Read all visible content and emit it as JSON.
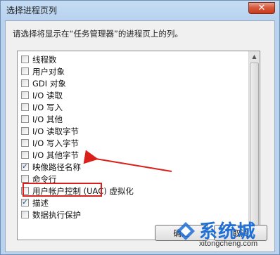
{
  "window": {
    "title": "选择进程页列",
    "close_glyph": "✕"
  },
  "instruction": "请选择将显示在“任务管理器”的进程页上的列。",
  "columns": [
    {
      "label": "线程数",
      "checked": false
    },
    {
      "label": "用户对象",
      "checked": false
    },
    {
      "label": "GDI 对象",
      "checked": false
    },
    {
      "label": "I/O 读取",
      "checked": false
    },
    {
      "label": "I/O 写入",
      "checked": false
    },
    {
      "label": "I/O 其他",
      "checked": false
    },
    {
      "label": "I/O 读取字节",
      "checked": false
    },
    {
      "label": "I/O 写入字节",
      "checked": false
    },
    {
      "label": "I/O 其他字节",
      "checked": false
    },
    {
      "label": "映像路径名称",
      "checked": true
    },
    {
      "label": "命令行",
      "checked": false
    },
    {
      "label": "用户帐户控制 (UAC) 虚拟化",
      "checked": false
    },
    {
      "label": "描述",
      "checked": true
    },
    {
      "label": "数据执行保护",
      "checked": false
    }
  ],
  "buttons": {
    "ok": "确定",
    "cancel": "取消"
  },
  "watermark": {
    "brand": "系统城",
    "url": "xitongcheng.com"
  },
  "colors": {
    "highlight": "#d9201b",
    "arrow": "#d9201b",
    "checkmark": "#1f4f8b"
  },
  "icons": {
    "close": "close-icon",
    "scroll_up": "chevron-up-icon",
    "scroll_down": "chevron-down-icon",
    "check": "checkmark-icon",
    "arrow": "arrow-left-icon"
  }
}
